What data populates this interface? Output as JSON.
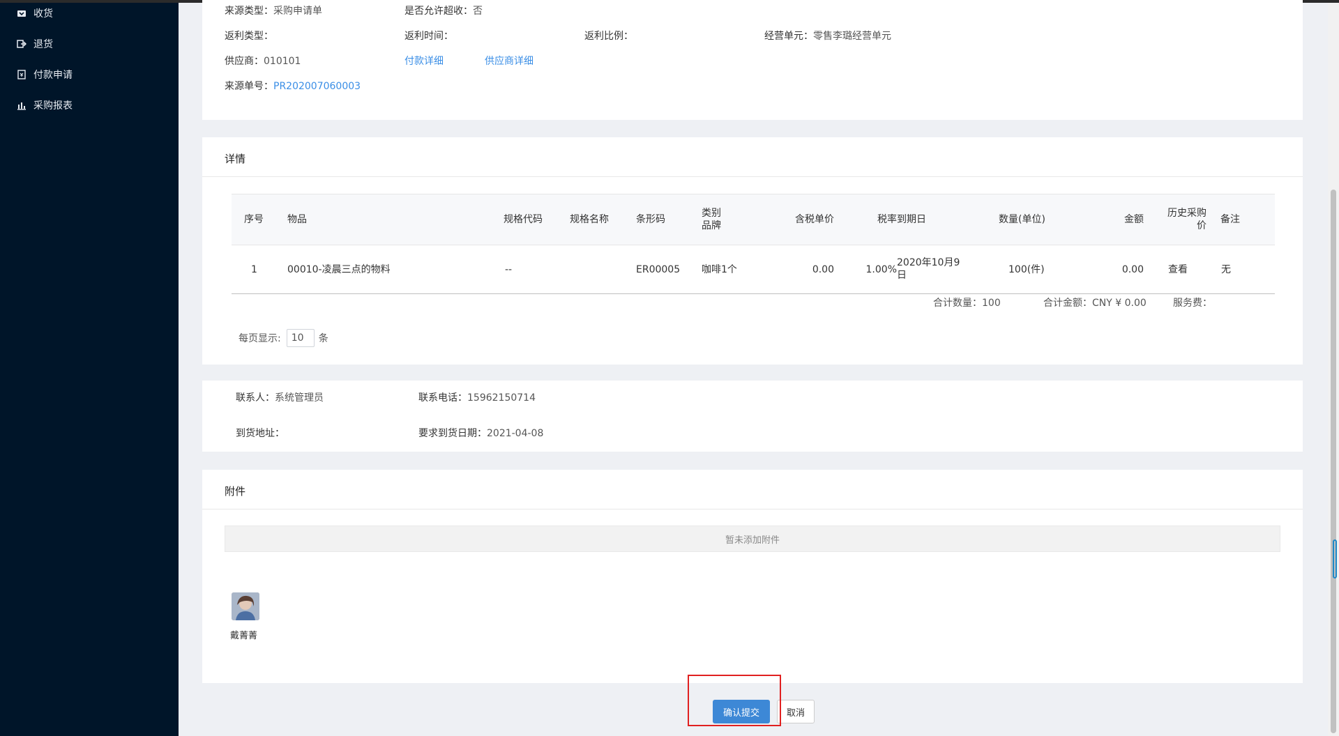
{
  "sidebar": {
    "items": [
      {
        "label": "收货",
        "icon": "inbox-icon"
      },
      {
        "label": "退货",
        "icon": "return-icon"
      },
      {
        "label": "付款申请",
        "icon": "payment-request-icon"
      },
      {
        "label": "采购报表",
        "icon": "bar-chart-icon"
      }
    ]
  },
  "info": {
    "source_type_label": "来源类型：",
    "source_type_value": "采购申请单",
    "over_receive_label": "是否允许超收：",
    "over_receive_value": "否",
    "rebate_type_label": "返利类型：",
    "rebate_time_label": "返利时间：",
    "rebate_ratio_label": "返利比例：",
    "business_unit_label": "经营单元：",
    "business_unit_value": "零售李璐经营单元",
    "supplier_label": "供应商：",
    "supplier_value": "010101",
    "payment_detail_link": "付款详细",
    "supplier_detail_link": "供应商详细",
    "source_no_label": "来源单号：",
    "source_no_value": "PR202007060003"
  },
  "details": {
    "title": "详情",
    "columns": [
      "序号",
      "物品",
      "规格代码",
      "规格名称",
      "条形码",
      "类别\n品牌",
      "含税单价",
      "税率",
      "到期日",
      "数量(单位)",
      "金额",
      "历史采购\n价",
      "备注"
    ],
    "rows": [
      {
        "index": "1",
        "item": "00010-凌晨三点的物料",
        "spec_code": "--",
        "spec_name": "",
        "barcode": "ER00005",
        "category": "咖啡1个",
        "unit_price": "0.00",
        "tax_rate": "1.00%",
        "due_date": "2020年10月9\n日",
        "quantity": "100(件)",
        "amount": "0.00",
        "history_link": "查看",
        "remark": "无"
      }
    ],
    "total_qty": "合计数量：100",
    "total_amount": "合计金额：CNY ¥ 0.00",
    "service_fee": "服务费：",
    "page_size_label": "每页显示:",
    "page_size_value": "10",
    "page_size_unit": "条"
  },
  "contact": {
    "person_label": "联系人：",
    "person_value": "系统管理员",
    "phone_label": "联系电话：",
    "phone_value": "15962150714",
    "address_label": "到货地址：",
    "date_label": "要求到货日期：",
    "date_value": "2021-04-08"
  },
  "attachment": {
    "title": "附件",
    "empty_text": "暂未添加附件",
    "user_name": "戴菁菁"
  },
  "actions": {
    "confirm": "确认提交",
    "cancel": "取消"
  },
  "colors": {
    "sidebar_bg": "#001529",
    "primary": "#3d88d6",
    "link": "#3a8ee6",
    "highlight": "#e02020"
  }
}
